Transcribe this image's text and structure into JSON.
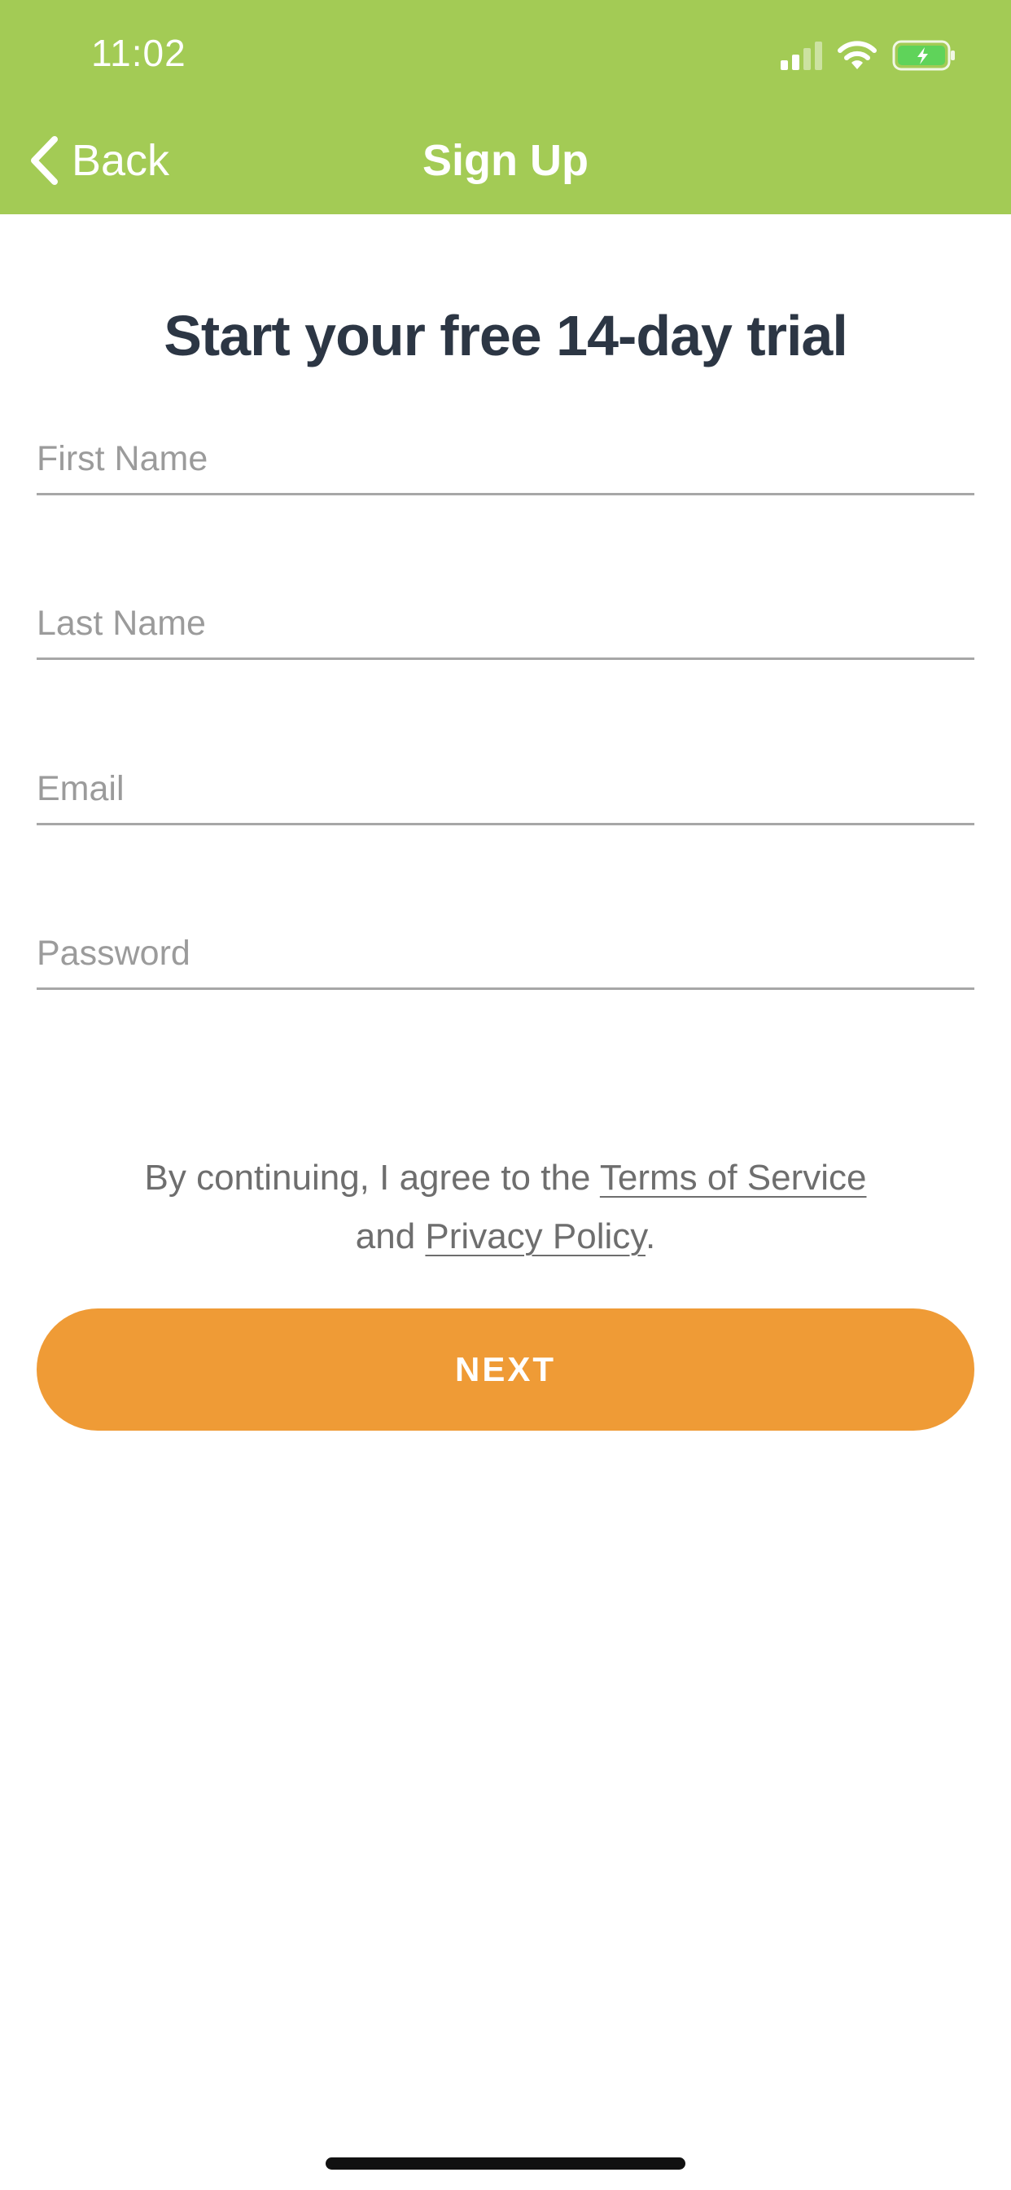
{
  "status_bar": {
    "time": "11:02",
    "icons": [
      "cellular-signal-icon",
      "wifi-icon",
      "battery-charging-icon"
    ]
  },
  "nav": {
    "back_label": "Back",
    "title": "Sign Up"
  },
  "form": {
    "headline": "Start your free 14-day trial",
    "fields": [
      {
        "placeholder": "First Name",
        "value": ""
      },
      {
        "placeholder": "Last Name",
        "value": ""
      },
      {
        "placeholder": "Email",
        "value": ""
      },
      {
        "placeholder": "Password",
        "value": ""
      }
    ],
    "consent": {
      "prefix": "By continuing, I agree to the",
      "terms_link": "Terms of Service",
      "middle": "and",
      "privacy_link": "Privacy Policy",
      "suffix": "."
    },
    "next_label": "NEXT"
  },
  "colors": {
    "header": "#a3cb55",
    "headline": "#2c3644",
    "button": "#ef9b36",
    "battery_fill": "#5fd35a"
  }
}
